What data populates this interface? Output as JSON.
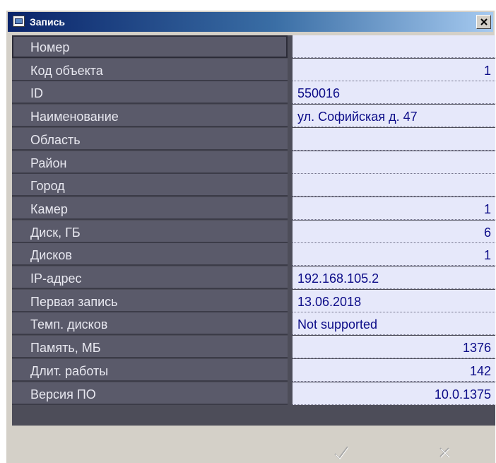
{
  "window": {
    "title": "Запись",
    "close_symbol": "×"
  },
  "rows": [
    {
      "label": "Номер",
      "value": "",
      "align": "left"
    },
    {
      "label": "Код объекта",
      "value": "1",
      "align": "right"
    },
    {
      "label": "ID",
      "value": "550016",
      "align": "left"
    },
    {
      "label": "Наименование",
      "value": "ул. Софийская д. 47",
      "align": "left"
    },
    {
      "label": "Область",
      "value": "",
      "align": "left"
    },
    {
      "label": "Район",
      "value": "",
      "align": "left"
    },
    {
      "label": "Город",
      "value": "",
      "align": "left"
    },
    {
      "label": "Камер",
      "value": "1",
      "align": "right"
    },
    {
      "label": "Диск, ГБ",
      "value": "6",
      "align": "right"
    },
    {
      "label": "Дисков",
      "value": "1",
      "align": "right"
    },
    {
      "label": "IP-адрес",
      "value": "192.168.105.2",
      "align": "left"
    },
    {
      "label": "Первая запись",
      "value": "13.06.2018",
      "align": "left"
    },
    {
      "label": "Темп. дисков",
      "value": "Not supported",
      "align": "left"
    },
    {
      "label": "Память, МБ",
      "value": "1376",
      "align": "right"
    },
    {
      "label": "Длит. работы",
      "value": "142",
      "align": "right"
    },
    {
      "label": "Версия ПО",
      "value": "10.0.1375",
      "align": "right"
    }
  ],
  "footer": {
    "ok_icon": "checkmark-icon",
    "cancel_icon": "cross-icon"
  },
  "colors": {
    "title_gradient_start": "#0a246a",
    "title_gradient_end": "#a6caf0",
    "label_background": "#5a5a6a",
    "value_background": "#e6e8fa",
    "value_text": "#0c0c88"
  }
}
